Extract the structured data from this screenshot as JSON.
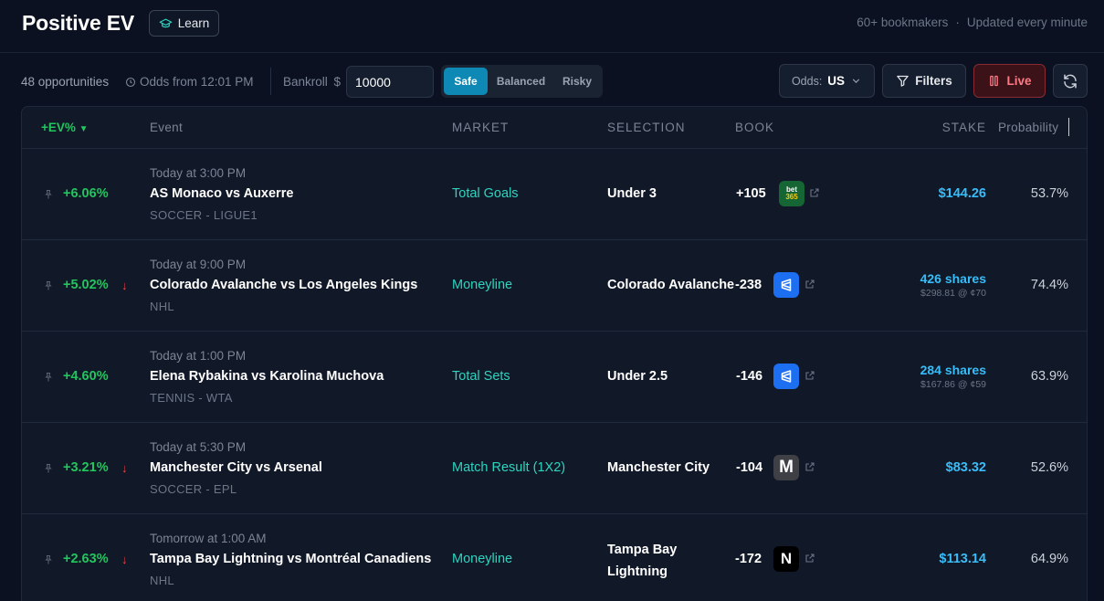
{
  "header": {
    "title": "Positive EV",
    "learn_label": "Learn",
    "bookmakers": "60+ bookmakers",
    "separator": "·",
    "updated": "Updated every minute"
  },
  "toolbar": {
    "opportunities": "48 opportunities",
    "odds_time": "Odds from 12:01 PM",
    "bankroll_label": "Bankroll",
    "currency": "$",
    "bankroll_value": "10000",
    "risk_options": [
      "Safe",
      "Balanced",
      "Risky"
    ],
    "risk_selected": "Safe",
    "odds_label": "Odds:",
    "odds_value": "US",
    "filters_label": "Filters",
    "live_label": "Live"
  },
  "table": {
    "columns": {
      "ev": "+EV%",
      "event": "Event",
      "market": "MARKET",
      "selection": "SELECTION",
      "book": "BOOK",
      "stake": "STAKE",
      "probability": "Probability"
    },
    "rows": [
      {
        "ev": "+6.06%",
        "trend": "",
        "time": "Today at 3:00 PM",
        "event": "AS Monaco vs Auxerre",
        "league": "SOCCER - LIGUE1",
        "market": "Total Goals",
        "selection": "Under 3",
        "odds": "+105",
        "book": "bet365-icon",
        "book_text": "bet365",
        "stake": "$144.26",
        "stake_sub": "",
        "probability": "53.7%"
      },
      {
        "ev": "+5.02%",
        "trend": "↓",
        "time": "Today at 9:00 PM",
        "event": "Colorado Avalanche vs Los Angeles Kings",
        "league": "NHL",
        "market": "Moneyline",
        "selection": "Colorado Avalanche",
        "odds": "-238",
        "book": "polymarket-icon",
        "book_text": "",
        "stake": "426 shares",
        "stake_sub": "$298.81 @ ¢70",
        "probability": "74.4%"
      },
      {
        "ev": "+4.60%",
        "trend": "↓",
        "time": "Today at 1:00 PM",
        "event": "Elena Rybakina vs Karolina Muchova",
        "league": "TENNIS - WTA",
        "market": "Total Sets",
        "selection": "Under 2.5",
        "odds": "-146",
        "book": "polymarket-icon",
        "book_text": "",
        "stake": "284 shares",
        "stake_sub": "$167.86 @ ¢59",
        "probability": "63.9%"
      },
      {
        "ev": "+3.21%",
        "trend": "↓",
        "time": "Today at 5:30 PM",
        "event": "Manchester City vs Arsenal",
        "league": "SOCCER - EPL",
        "market": "Match Result (1X2)",
        "selection": "Manchester City",
        "odds": "-104",
        "book": "m-book-icon",
        "book_text": "M",
        "stake": "$83.32",
        "stake_sub": "",
        "probability": "52.6%"
      },
      {
        "ev": "+2.63%",
        "trend": "↓",
        "time": "Tomorrow at 1:00 AM",
        "event": "Tampa Bay Lightning vs Montréal Canadiens",
        "league": "NHL",
        "market": "Moneyline",
        "selection_lines": [
          "Tampa Bay",
          "Lightning"
        ],
        "odds": "-172",
        "book": "n-book-icon",
        "book_text": "N",
        "stake": "$113.14",
        "stake_sub": "",
        "probability": "64.9%"
      }
    ]
  },
  "colors": {
    "background": "#0b1120",
    "positive_ev": "#22c55e",
    "market": "#2dd4bf",
    "stake": "#38bdf8",
    "accent": "#0e88b4",
    "live": "#ff7a85"
  }
}
